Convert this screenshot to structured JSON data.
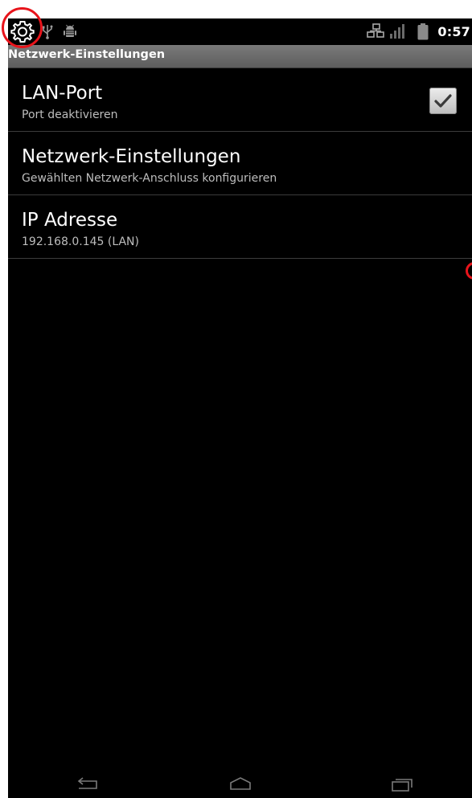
{
  "status_bar": {
    "time": "0:57",
    "icons": [
      "settings-gear-icon",
      "usb-icon",
      "debug-android-icon",
      "network-icon",
      "signal-icon",
      "battery-icon"
    ]
  },
  "title_bar": {
    "title": "Netzwerk-Einstellungen"
  },
  "preferences": [
    {
      "title": "LAN-Port",
      "summary": "Port deaktivieren",
      "checked": true
    },
    {
      "title": "Netzwerk-Einstellungen",
      "summary": "Gewählten Netzwerk-Anschluss konfigurieren"
    },
    {
      "title": "IP Adresse",
      "summary": "192.168.0.145 (LAN)"
    }
  ],
  "nav_bar": {
    "buttons": [
      "back",
      "home",
      "recent-apps"
    ]
  },
  "colors": {
    "background": "#000000",
    "title_bar": "#6c6c6c",
    "annotation": "#e8141b",
    "summary_text": "#bdbdbd"
  }
}
